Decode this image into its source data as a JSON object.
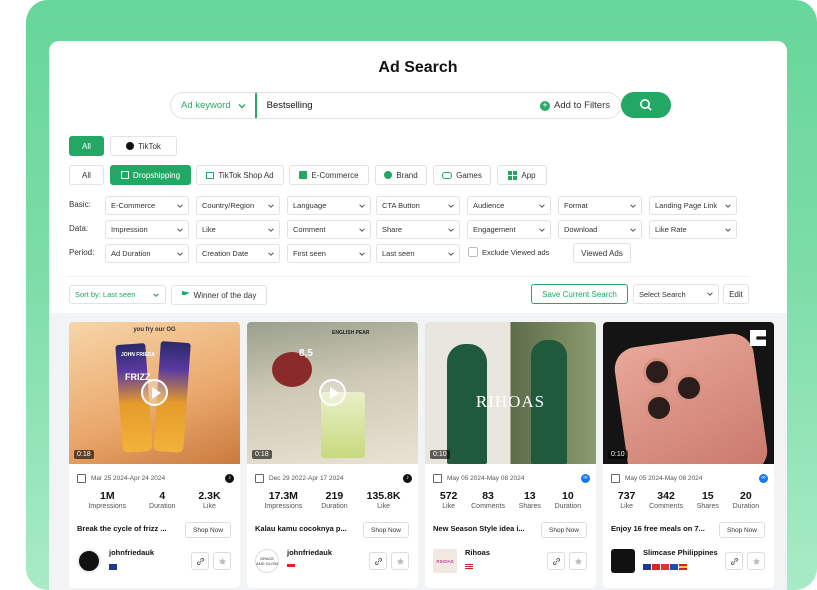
{
  "page": {
    "title": "Ad Search"
  },
  "search": {
    "keyword_type": "Ad keyword",
    "value": "Bestselling",
    "add_filters": "Add to Filters"
  },
  "platforms": [
    "All",
    "TikTok"
  ],
  "categories": [
    "All",
    "Dropshipping",
    "TikTok Shop Ad",
    "E-Commerce",
    "Brand",
    "Games",
    "App"
  ],
  "filters": {
    "basic_label": "Basic:",
    "basic": [
      "E-Commerce",
      "Country/Region",
      "Language",
      "CTA Button",
      "Audience",
      "Format",
      "Landing Page Link"
    ],
    "data_label": "Data:",
    "data": [
      "Impression",
      "Like",
      "Comment",
      "Share",
      "Engagement",
      "Download",
      "Like Rate"
    ],
    "period_label": "Period:",
    "period": [
      "Ad Duration",
      "Creation Date",
      "First seen",
      "Last seen"
    ],
    "exclude_viewed": "Exclude Viewed ads",
    "viewed_ads": "Viewed Ads"
  },
  "toolbar": {
    "sort": "Sort by: Last seen",
    "winner": "Winner of the day",
    "save_search": "Save Current Search",
    "select_search": "Select Search",
    "edit": "Edit"
  },
  "cards": [
    {
      "duration": "0:18",
      "date": "Mar 25 2024-Apr 24 2024",
      "platform": "tiktok",
      "stats": [
        {
          "v": "1M",
          "l": "Impressions"
        },
        {
          "v": "4",
          "l": "Duration"
        },
        {
          "v": "2.3K",
          "l": "Like"
        }
      ],
      "desc": "Break the cycle of frizz ...",
      "cta": "Shop Now",
      "advertiser": "johnfriedauk",
      "overlay_text": "you fry our OG",
      "brand_text": "JOHN FRIEDA",
      "product_text": "FRIZZ"
    },
    {
      "duration": "0:18",
      "date": "Dec 29 2022-Apr 17 2024",
      "platform": "tiktok",
      "stats": [
        {
          "v": "17.3M",
          "l": "Impressions"
        },
        {
          "v": "219",
          "l": "Duration"
        },
        {
          "v": "135.8K",
          "l": "Like"
        }
      ],
      "desc": "Kalau kamu cocoknya p...",
      "cta": "Shop Now",
      "advertiser": "johnfriedauk",
      "overlay_text": "ENGLISH PEAR",
      "overlay_num": "8,5",
      "avatar_text": "GRACE AND GLOW"
    },
    {
      "duration": "0:10",
      "date": "May 05 2024-May 08 2024",
      "platform": "meta",
      "stats": [
        {
          "v": "572",
          "l": "Like"
        },
        {
          "v": "83",
          "l": "Comments"
        },
        {
          "v": "13",
          "l": "Shares"
        },
        {
          "v": "10",
          "l": "Duration"
        }
      ],
      "desc": "New Season Style idea i...",
      "cta": "Shop Now",
      "advertiser": "Rihoas",
      "overlay_text": "RIHOAS",
      "avatar_text": "RIHOAS"
    },
    {
      "duration": "0:10",
      "date": "May 05 2024-May 08 2024",
      "platform": "meta",
      "stats": [
        {
          "v": "737",
          "l": "Like"
        },
        {
          "v": "342",
          "l": "Comments"
        },
        {
          "v": "15",
          "l": "Shares"
        },
        {
          "v": "20",
          "l": "Duration"
        }
      ],
      "desc": "Enjoy 16 free meals on 7...",
      "cta": "Shop Now",
      "advertiser": "Slimcase Philippines"
    }
  ],
  "colors": {
    "accent": "#22a864",
    "background_gradient": "#66d69a"
  }
}
